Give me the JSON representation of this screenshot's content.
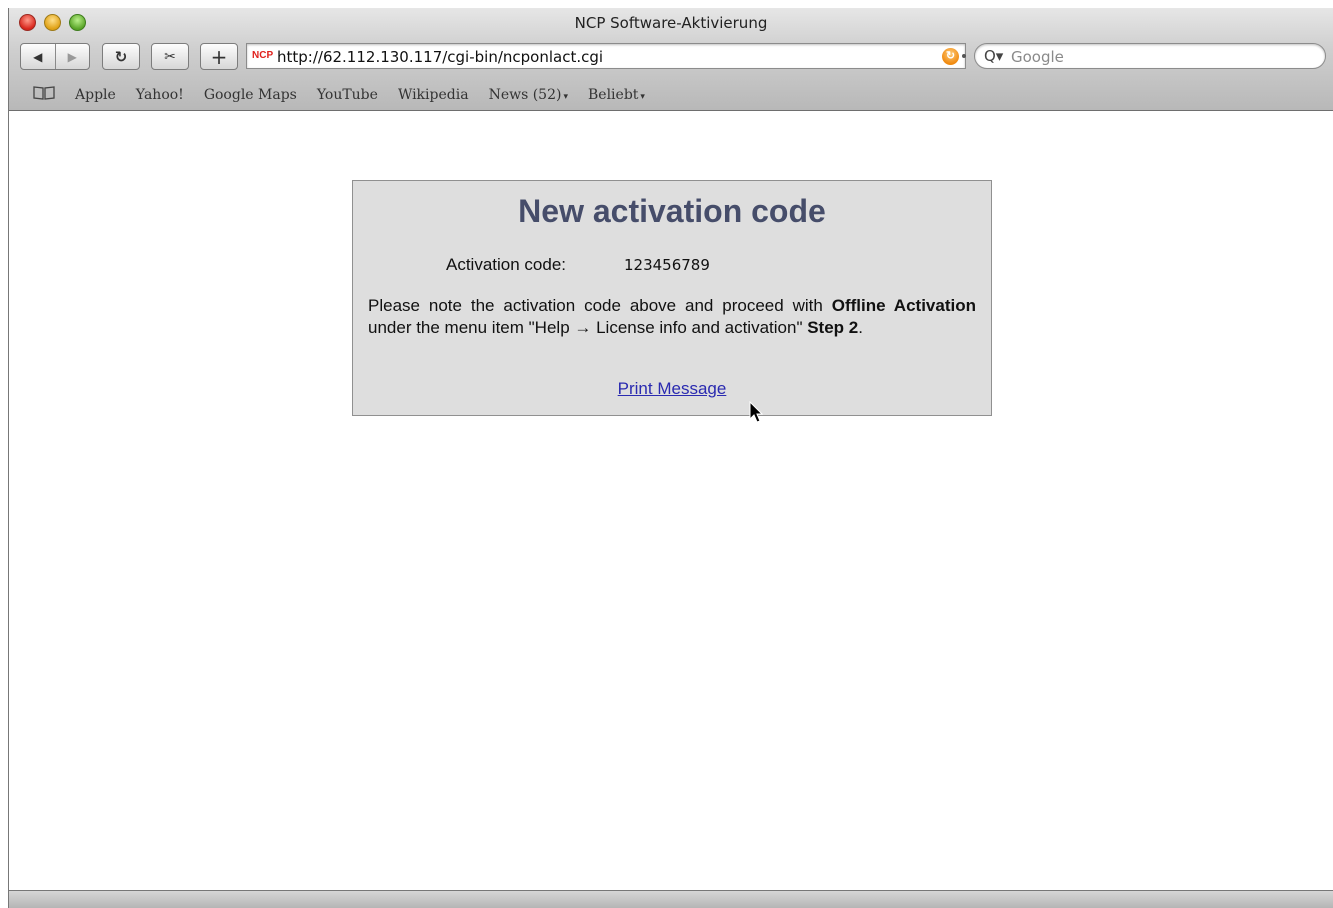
{
  "window": {
    "title": "NCP Software-Aktivierung"
  },
  "toolbar": {
    "back_glyph": "◀",
    "forward_glyph": "▶",
    "reload_glyph": "↻",
    "snip_glyph": "✂",
    "add_glyph": "+",
    "favicon_text": "NCP",
    "url": "http://62.112.130.117/cgi-bin/ncponlact.cgi",
    "rss_glyph": "↻",
    "search_placeholder": "Google",
    "search_glyph": "Q▾"
  },
  "bookmarks": {
    "book_glyph": "📖",
    "items": [
      {
        "label": "Apple"
      },
      {
        "label": "Yahoo!"
      },
      {
        "label": "Google Maps"
      },
      {
        "label": "YouTube"
      },
      {
        "label": "Wikipedia"
      },
      {
        "label": "News (52)",
        "menu": true
      },
      {
        "label": "Beliebt",
        "menu": true
      }
    ],
    "caret": "▾"
  },
  "page": {
    "heading": "New activation code",
    "code_label": "Activation code:",
    "code_value": "123456789",
    "instructions": {
      "part1": "Please note the activation code above and proceed with ",
      "bold1": "Offline Activation",
      "part2": " under the menu item \"Help → License info and activation\" ",
      "bold2": "Step 2",
      "part3": "."
    },
    "print_link": "Print Message"
  },
  "colors": {
    "heading": "#464d6a",
    "card_bg": "#dedede",
    "link": "#2a2ab0"
  },
  "icons": [
    "back-icon",
    "forward-icon",
    "reload-icon",
    "snip-icon",
    "add-bookmark-icon",
    "rss-icon",
    "search-icon",
    "bookmarks-book-icon",
    "cursor-icon"
  ]
}
